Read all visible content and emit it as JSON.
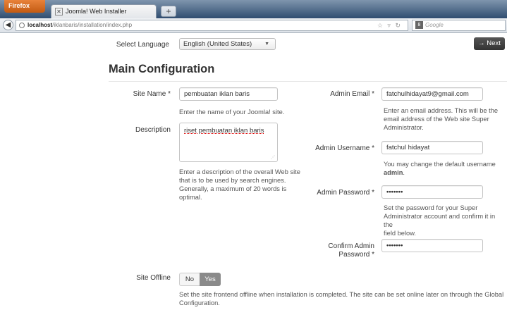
{
  "browser": {
    "firefox_button": "Firefox",
    "tab_title": "Joomla! Web Installer",
    "new_tab": "+",
    "url_host": "localhost",
    "url_path": "/iklanbaris/installation/index.php",
    "search_placeholder": "Google",
    "search_engine": "8"
  },
  "header": {
    "select_language_label": "Select Language",
    "language_value": "English (United States)",
    "next_button": "→ Next"
  },
  "main": {
    "title": "Main Configuration",
    "site_name_label": "Site Name *",
    "site_name_value": "pembuatan iklan baris",
    "site_name_help": "Enter the name of your Joomla! site.",
    "description_label": "Description",
    "description_value": "riset pembuatan iklan baris",
    "description_help": [
      "Enter a description of the overall Web site",
      "that is to be used by search engines.",
      "Generally, a maximum of 20 words is",
      "optimal."
    ],
    "admin_email_label": "Admin Email *",
    "admin_email_value": "fatchulhidayat9@gmail.com",
    "admin_email_help": [
      "Enter an email address. This will be the",
      "email address of the Web site Super",
      "Administrator."
    ],
    "admin_username_label": "Admin Username *",
    "admin_username_value": "fatchul hidayat",
    "admin_username_help_1": "You may change the default username",
    "admin_username_help_2": "admin",
    "admin_username_help_end": ".",
    "admin_password_label": "Admin Password *",
    "admin_password_value": "•••••••",
    "admin_password_help": [
      "Set the password for your Super",
      "Administrator account and confirm it in the",
      "field below."
    ],
    "confirm_password_label_1": "Confirm Admin",
    "confirm_password_label_2": "Password *",
    "confirm_password_value": "•••••••",
    "site_offline_label": "Site Offline",
    "offline_no": "No",
    "offline_yes": "Yes",
    "site_offline_help": [
      "Set the site frontend offline when installation is completed. The site can be set online later on through the Global",
      "Configuration."
    ]
  }
}
